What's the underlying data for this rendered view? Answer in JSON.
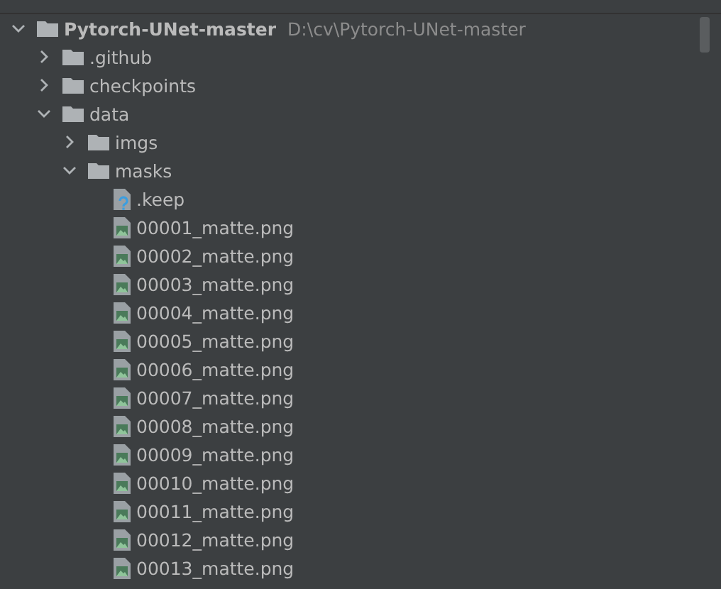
{
  "tree": {
    "name": "Pytorch-UNet-master",
    "path": "D:\\cv\\Pytorch-UNet-master",
    "kind": "folder",
    "expanded": true,
    "children": [
      {
        "name": ".github",
        "kind": "folder",
        "expanded": false
      },
      {
        "name": "checkpoints",
        "kind": "folder",
        "expanded": false
      },
      {
        "name": "data",
        "kind": "folder",
        "expanded": true,
        "children": [
          {
            "name": "imgs",
            "kind": "folder",
            "expanded": false
          },
          {
            "name": "masks",
            "kind": "folder",
            "expanded": true,
            "children": [
              {
                "name": ".keep",
                "kind": "unknown"
              },
              {
                "name": "00001_matte.png",
                "kind": "image"
              },
              {
                "name": "00002_matte.png",
                "kind": "image"
              },
              {
                "name": "00003_matte.png",
                "kind": "image"
              },
              {
                "name": "00004_matte.png",
                "kind": "image"
              },
              {
                "name": "00005_matte.png",
                "kind": "image"
              },
              {
                "name": "00006_matte.png",
                "kind": "image"
              },
              {
                "name": "00007_matte.png",
                "kind": "image"
              },
              {
                "name": "00008_matte.png",
                "kind": "image"
              },
              {
                "name": "00009_matte.png",
                "kind": "image"
              },
              {
                "name": "00010_matte.png",
                "kind": "image"
              },
              {
                "name": "00011_matte.png",
                "kind": "image"
              },
              {
                "name": "00012_matte.png",
                "kind": "image"
              },
              {
                "name": "00013_matte.png",
                "kind": "image"
              }
            ]
          }
        ]
      }
    ]
  }
}
